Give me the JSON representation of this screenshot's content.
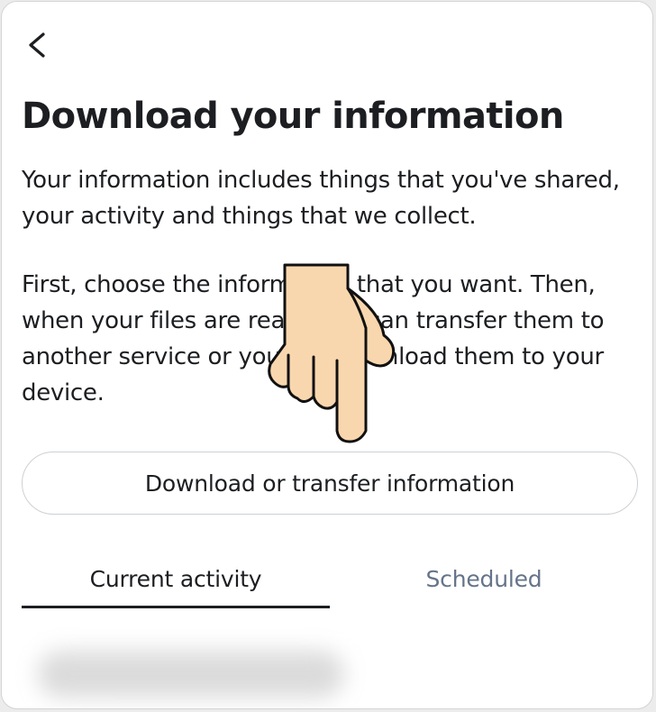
{
  "header": {
    "back_icon": "chevron-left-icon"
  },
  "page": {
    "title": "Download your information",
    "description_1": "Your information includes things that you've shared, your activity and things that we collect.",
    "description_2": "First, choose the information that you want. Then, when your files are ready, we can transfer them to another service or you can download them to your device."
  },
  "actions": {
    "download_button_label": "Download or transfer information"
  },
  "tabs": [
    {
      "label": "Current activity",
      "active": true
    },
    {
      "label": "Scheduled",
      "active": false
    }
  ],
  "colors": {
    "text_primary": "#1c1e21",
    "text_secondary": "#65748a",
    "hand_fill": "#f9d7ae",
    "border": "#cdd0d4"
  }
}
